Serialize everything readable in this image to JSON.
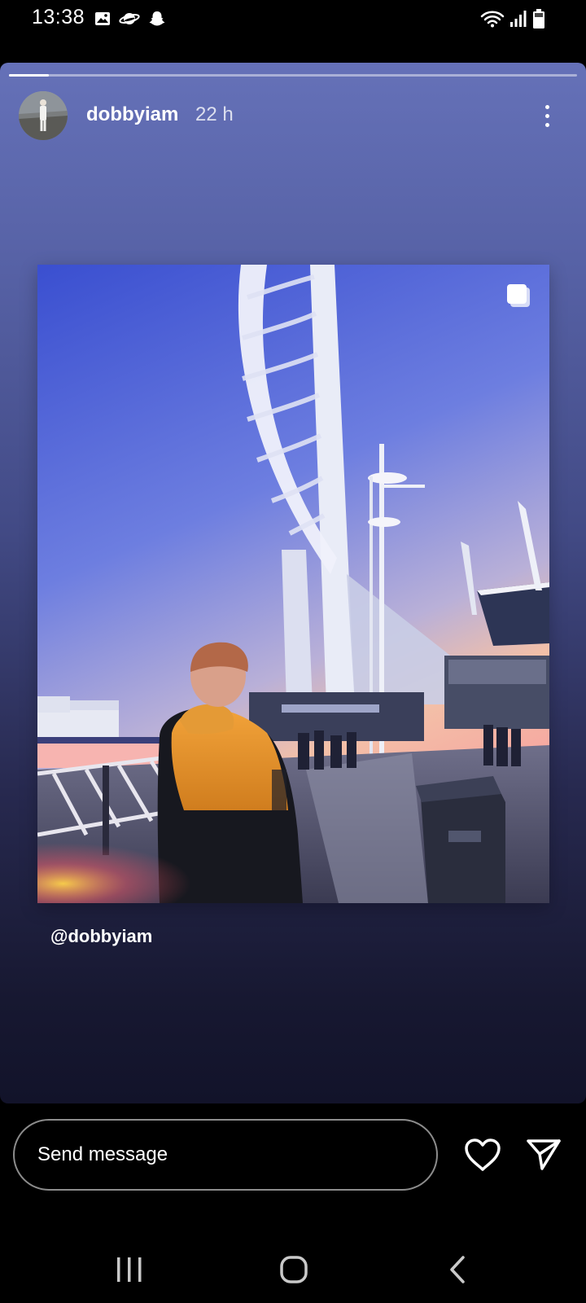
{
  "status_bar": {
    "time": "13:38",
    "left_icons": [
      "gallery-icon",
      "saturn-icon",
      "snapchat-icon"
    ],
    "right_icons": [
      "wifi-icon",
      "signal-icon",
      "battery-icon"
    ]
  },
  "story": {
    "progress": 0.07,
    "username": "dobbyiam",
    "time_ago": "22 h",
    "more_icon": "more-vertical-icon",
    "multi_post_icon": "carousel-icon",
    "mention": "@dobbyiam",
    "background_colors": [
      "#6571b8",
      "#12132a"
    ]
  },
  "reply_bar": {
    "placeholder": "Send message",
    "like_icon": "heart-icon",
    "share_icon": "send-icon"
  },
  "nav_bar": {
    "icons": [
      "recents-icon",
      "home-icon",
      "back-icon"
    ]
  }
}
